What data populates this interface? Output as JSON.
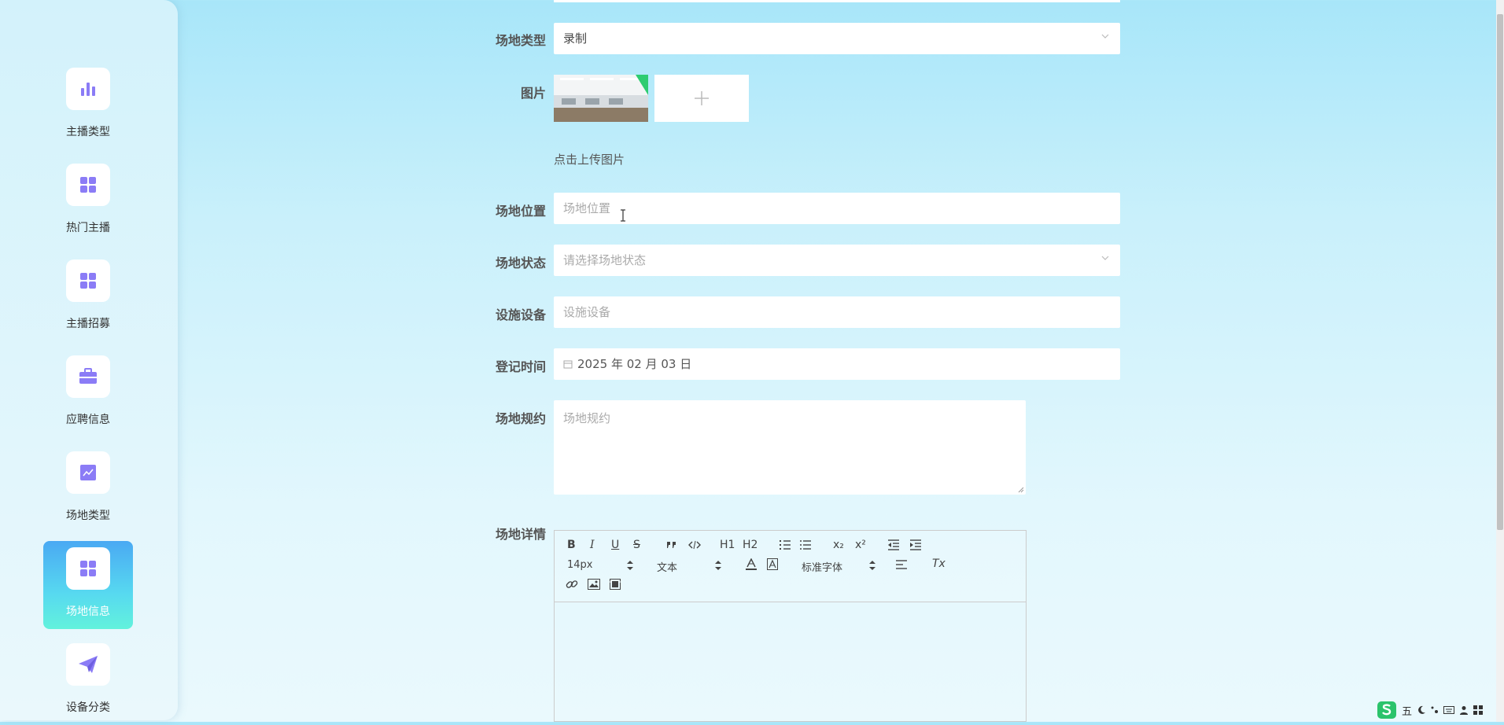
{
  "sidebar": {
    "items": [
      {
        "label": "主播类型",
        "icon": "bar-chart-icon",
        "active": false
      },
      {
        "label": "热门主播",
        "icon": "grid-icon",
        "active": false
      },
      {
        "label": "主播招募",
        "icon": "grid-icon",
        "active": false
      },
      {
        "label": "应聘信息",
        "icon": "briefcase-icon",
        "active": false
      },
      {
        "label": "场地类型",
        "icon": "line-chart-icon",
        "active": false
      },
      {
        "label": "场地信息",
        "icon": "grid-icon",
        "active": true
      },
      {
        "label": "设备分类",
        "icon": "paper-plane-icon",
        "active": false
      }
    ]
  },
  "form": {
    "venue_type": {
      "label": "场地类型",
      "value": "录制"
    },
    "image": {
      "label": "图片",
      "hint": "点击上传图片"
    },
    "venue_location": {
      "label": "场地位置",
      "placeholder": "场地位置"
    },
    "venue_status": {
      "label": "场地状态",
      "placeholder": "请选择场地状态"
    },
    "facilities": {
      "label": "设施设备",
      "placeholder": "设施设备"
    },
    "register_time": {
      "label": "登记时间",
      "value": "2025 年 02 月 03 日"
    },
    "venue_rules": {
      "label": "场地规约",
      "placeholder": "场地规约"
    },
    "venue_details": {
      "label": "场地详情"
    }
  },
  "editor": {
    "font_size": "14px",
    "text_type": "文本",
    "font_family": "标准字体",
    "buttons": {
      "bold": "B",
      "italic": "I",
      "underline": "U",
      "strike": "S",
      "h1": "H1",
      "h2": "H2",
      "sub": "x₂",
      "sup": "x²",
      "clear": "Tx"
    }
  },
  "tray": {
    "ime": "五"
  },
  "colors": {
    "accent": "#8b7cf6",
    "active_top": "#4aa9f3",
    "active_bottom": "#62f2dc"
  }
}
